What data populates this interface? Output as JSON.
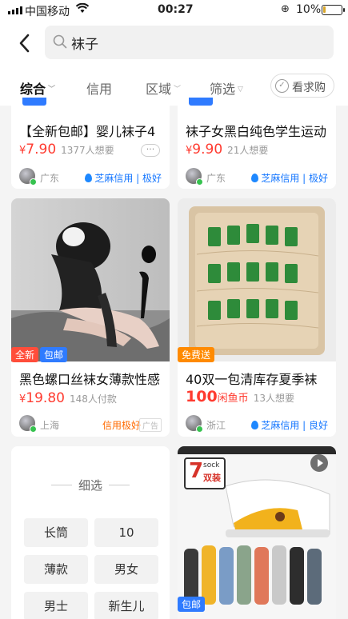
{
  "status_bar": {
    "carrier": "中国移动",
    "time": "00:27",
    "battery": "10%"
  },
  "search": {
    "query": "袜子"
  },
  "filters": {
    "items": [
      "综合",
      "信用",
      "区域",
      "筛选"
    ],
    "want_buy": "看求购"
  },
  "cards": [
    {
      "title": "【全新包邮】婴儿袜子4",
      "price_symbol": "¥",
      "price": "7.90",
      "wants": "1377人想要",
      "location": "广东",
      "credit": "芝麻信用 | 极好",
      "more": "···"
    },
    {
      "title": "袜子女黑白纯色学生运动",
      "price_symbol": "¥",
      "price": "9.90",
      "wants": "21人想要",
      "location": "广东",
      "credit": "芝麻信用 | 极好"
    },
    {
      "badges": [
        "全新",
        "包邮"
      ],
      "title": "黑色螺口丝袜女薄款性感",
      "price_symbol": "¥",
      "price": "19.80",
      "wants": "148人付款",
      "location": "上海",
      "credit": "信用极好",
      "ad": "广告"
    },
    {
      "badges": [
        "免费送"
      ],
      "title": "40双一包清库存夏季袜",
      "price": "100",
      "price_unit": "闲鱼币",
      "wants": "13人想要",
      "location": "浙江",
      "credit": "芝麻信用 | 良好"
    },
    {
      "badges": [
        "包邮"
      ],
      "image_text": {
        "big": "7",
        "sock": "sock",
        "pairs": "双装"
      }
    }
  ],
  "refine": {
    "heading": "细选",
    "chips": [
      "长筒",
      "10",
      "薄款",
      "男女",
      "男士",
      "新生儿"
    ]
  },
  "colors": {
    "price_red": "#ff3b30",
    "credit_blue": "#1677ff",
    "credit_orange": "#ff6a00"
  }
}
